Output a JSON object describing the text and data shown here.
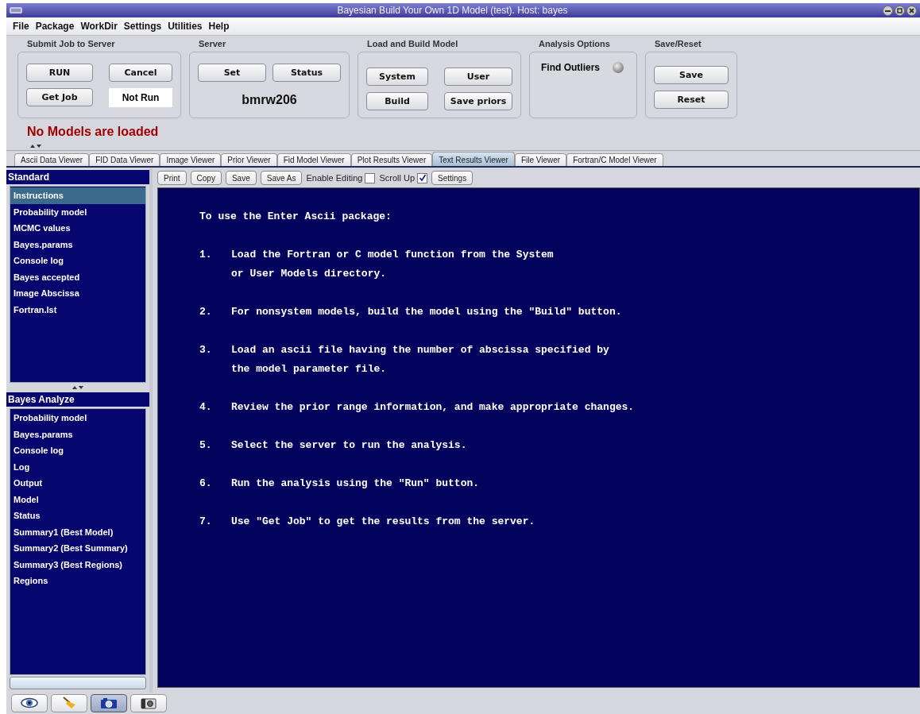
{
  "window": {
    "title": "Bayesian Build Your Own 1D Model  (test).  Host: bayes"
  },
  "menu": [
    "File",
    "Package",
    "WorkDir",
    "Settings",
    "Utilities",
    "Help"
  ],
  "groups": [
    {
      "title": "Submit Job to Server",
      "kind": "buttons",
      "buttons": [
        "RUN",
        "Cancel",
        "Get Job"
      ],
      "status": "Not Run"
    },
    {
      "title": "Server",
      "kind": "server",
      "buttons": [
        "Set",
        "Status"
      ],
      "server_name": "bmrw206"
    },
    {
      "title": "Load and Build Model",
      "kind": "buttons",
      "buttons": [
        "System",
        "User",
        "Build",
        "Save priors"
      ]
    },
    {
      "title": "Analysis Options",
      "kind": "options",
      "option": {
        "label": "Find Outliers",
        "on": false
      }
    },
    {
      "title": "Save/Reset",
      "kind": "stack",
      "buttons": [
        "Save",
        "Reset"
      ]
    }
  ],
  "message": "No Models are loaded",
  "tabs": [
    {
      "label": "Ascii Data Viewer",
      "selected": false
    },
    {
      "label": "FID Data Viewer",
      "selected": false
    },
    {
      "label": "Image Viewer",
      "selected": false
    },
    {
      "label": "Prior Viewer",
      "selected": false
    },
    {
      "label": "Fid Model Viewer",
      "selected": false
    },
    {
      "label": "Plot Results Viewer",
      "selected": false
    },
    {
      "label": "Text Results Viewer",
      "selected": true
    },
    {
      "label": "File Viewer",
      "selected": false
    },
    {
      "label": "Fortran/C Model Viewer",
      "selected": false
    }
  ],
  "sidebar": [
    {
      "title": "Standard",
      "items": [
        {
          "label": "Instructions",
          "selected": true
        },
        {
          "label": "Probability model",
          "selected": false
        },
        {
          "label": "MCMC values",
          "selected": false
        },
        {
          "label": "Bayes.params",
          "selected": false
        },
        {
          "label": "Console log",
          "selected": false
        },
        {
          "label": "Bayes accepted",
          "selected": false
        },
        {
          "label": "Image Abscissa",
          "selected": false
        },
        {
          "label": "Fortran.lst",
          "selected": false
        }
      ]
    },
    {
      "title": "Bayes Analyze",
      "items": [
        {
          "label": "Probability model",
          "selected": false
        },
        {
          "label": "Bayes.params",
          "selected": false
        },
        {
          "label": "Console log",
          "selected": false
        },
        {
          "label": "Log",
          "selected": false
        },
        {
          "label": "Output",
          "selected": false
        },
        {
          "label": "Model",
          "selected": false
        },
        {
          "label": "Status",
          "selected": false
        },
        {
          "label": "Summary1 (Best Model)",
          "selected": false
        },
        {
          "label": "Summary2 (Best Summary)",
          "selected": false
        },
        {
          "label": "Summary3 (Best Regions)",
          "selected": false
        },
        {
          "label": "Regions",
          "selected": false
        }
      ]
    }
  ],
  "viewer_toolbar": [
    {
      "kind": "button",
      "label": "Print"
    },
    {
      "kind": "button",
      "label": "Copy"
    },
    {
      "kind": "button",
      "label": "Save"
    },
    {
      "kind": "button",
      "label": "Save As"
    },
    {
      "kind": "checkbox",
      "label": "Enable Editing",
      "checked": false
    },
    {
      "kind": "checkbox",
      "label": "Scroll Up",
      "checked": true
    },
    {
      "kind": "button",
      "label": "Settings"
    }
  ],
  "text_view": {
    "heading": "To use the Enter Ascii package:",
    "steps": [
      {
        "number": "1.",
        "lines": [
          "Load the Fortran or C model function from the System",
          "or User Models directory."
        ]
      },
      {
        "number": "2.",
        "lines": [
          "For nonsystem models, build the model using the \"Build\" button."
        ]
      },
      {
        "number": "3.",
        "lines": [
          "Load an ascii file having the number of abscissa specified by",
          "the model parameter file."
        ]
      },
      {
        "number": "4.",
        "lines": [
          "Review the prior range information, and make appropriate changes."
        ]
      },
      {
        "number": "5.",
        "lines": [
          "Select the server to run the analysis."
        ]
      },
      {
        "number": "6.",
        "lines": [
          "Run the analysis using the \"Run\" button."
        ]
      },
      {
        "number": "7.",
        "lines": [
          "Use \"Get Job\" to get the results from the server."
        ]
      }
    ]
  },
  "bottom_tools": [
    {
      "kind": "eye",
      "selected": false
    },
    {
      "kind": "broom",
      "selected": false
    },
    {
      "kind": "camera",
      "selected": true
    },
    {
      "kind": "compact-camera",
      "selected": false
    }
  ]
}
